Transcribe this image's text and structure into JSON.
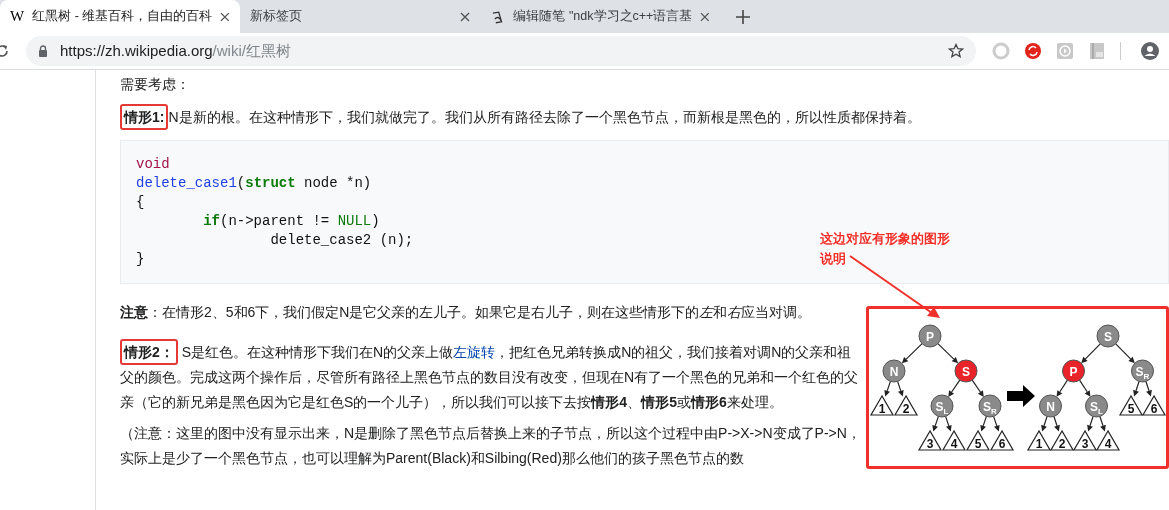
{
  "browser": {
    "tabs": [
      {
        "title": "红黑树 - 维基百科，自由的百科",
        "favicon": "W",
        "selected": true
      },
      {
        "title": "新标签页",
        "selected": false
      },
      {
        "title": "编辑随笔 \"ndk学习之c++语言基",
        "selected": false
      }
    ],
    "url_host": "https://zh.wikipedia.org",
    "url_path": "/wiki/红黑树",
    "extensions": [
      {
        "kind": "ring"
      },
      {
        "kind": "refresh"
      },
      {
        "kind": "play"
      },
      {
        "kind": "document"
      }
    ]
  },
  "article": {
    "intro": "需要考虑：",
    "case1": {
      "label": "情形1:",
      "boxed": true,
      "text": "N是新的根。在这种情形下，我们就做完了。我们从所有路径去除了一个黑色节点，而新根是黑色的，所以性质都保持着。"
    },
    "code": [
      [
        {
          "text": "void",
          "kind": "type"
        }
      ],
      [
        {
          "text": "delete_case1",
          "kind": "function"
        },
        {
          "text": "(",
          "kind": "plain"
        },
        {
          "text": "struct",
          "kind": "keyword"
        },
        {
          "text": " node *n)",
          "kind": "plain"
        }
      ],
      [
        {
          "text": "{",
          "kind": "plain"
        }
      ],
      [
        {
          "text": "        if",
          "kind": "keyword"
        },
        {
          "text": "(n->parent != ",
          "kind": "plain"
        },
        {
          "text": "NULL",
          "kind": "constant"
        },
        {
          "text": ")",
          "kind": "plain"
        }
      ],
      [
        {
          "text": "                delete_case2 (n);",
          "kind": "plain"
        }
      ],
      [
        {
          "text": "}",
          "kind": "plain"
        }
      ]
    ],
    "note": {
      "parts": [
        {
          "kind": "bold",
          "text": "注意"
        },
        {
          "kind": "text",
          "text": "：在情形2、5和6下，我们假定N是它父亲的左儿子。如果它是右儿子，则在这些情形下的"
        },
        {
          "kind": "italic",
          "text": "左"
        },
        {
          "kind": "text",
          "text": "和"
        },
        {
          "kind": "italic",
          "text": "右"
        },
        {
          "kind": "text",
          "text": "应当对调。"
        }
      ]
    },
    "case2": {
      "label": "情形2：",
      "boxed": true,
      "parts": [
        {
          "kind": "text",
          "text": " S是红色。在这种情形下我们在N的父亲上做"
        },
        {
          "kind": "link",
          "text": "左旋转"
        },
        {
          "kind": "text",
          "text": "，把红色兄弟转换成N的祖父，我们接着对调N的父亲和祖父的颜色。完成这两个操作后，尽管所有路径上黑色节点的数目没有改变，但现在N有了一个黑色的兄弟和一个红色的父亲（它的新兄弟是黑色因为它是红色S的一个儿子），所以我们可以接下去按**情形4**、**情形5**或**情形6**来处理。"
        }
      ]
    },
    "remark": {
      "parts": [
        {
          "kind": "text",
          "text": "（注意：这里的图中没有显示出来，N是删除了黑色节点后替换上来的子节点，所以这个过程中由P->X->N变成了P->N，实际上是少了一个黑色节点，也可以理解为Parent(Black)和Silbing(Red)那么他们的孩子黑色节点的数"
        }
      ]
    },
    "diagram": {
      "trees": [
        {
          "kind": "node",
          "label": "P",
          "color": "#8a8a8a",
          "children": [
            {
              "kind": "node",
              "label": "N",
              "color": "#8a8a8a",
              "children": [
                {
                  "kind": "leaf",
                  "label": "1"
                },
                {
                  "kind": "leaf",
                  "label": "2"
                }
              ]
            },
            {
              "kind": "node",
              "label": "S",
              "color": "#e8232a",
              "children": [
                {
                  "kind": "node",
                  "label": "S",
                  "sub": "L",
                  "color": "#8a8a8a",
                  "children": [
                    {
                      "kind": "leaf",
                      "label": "3"
                    },
                    {
                      "kind": "leaf",
                      "label": "4"
                    }
                  ]
                },
                {
                  "kind": "node",
                  "label": "S",
                  "sub": "R",
                  "color": "#8a8a8a",
                  "children": [
                    {
                      "kind": "leaf",
                      "label": "5"
                    },
                    {
                      "kind": "leaf",
                      "label": "6"
                    }
                  ]
                }
              ]
            }
          ]
        },
        {
          "kind": "node",
          "label": "S",
          "color": "#8a8a8a",
          "children": [
            {
              "kind": "node",
              "label": "P",
              "color": "#e8232a",
              "children": [
                {
                  "kind": "node",
                  "label": "N",
                  "color": "#8a8a8a",
                  "children": [
                    {
                      "kind": "leaf",
                      "label": "1"
                    },
                    {
                      "kind": "leaf",
                      "label": "2"
                    }
                  ]
                },
                {
                  "kind": "node",
                  "label": "S",
                  "sub": "L",
                  "color": "#8a8a8a",
                  "children": [
                    {
                      "kind": "leaf",
                      "label": "3"
                    },
                    {
                      "kind": "leaf",
                      "label": "4"
                    }
                  ]
                }
              ]
            },
            {
              "kind": "node",
              "label": "S",
              "sub": "R",
              "color": "#8a8a8a",
              "children": [
                {
                  "kind": "leaf",
                  "label": "5"
                },
                {
                  "kind": "leaf",
                  "label": "6"
                }
              ]
            }
          ]
        }
      ]
    }
  },
  "annotation": {
    "callout": "这边对应有形象的图形说明"
  }
}
